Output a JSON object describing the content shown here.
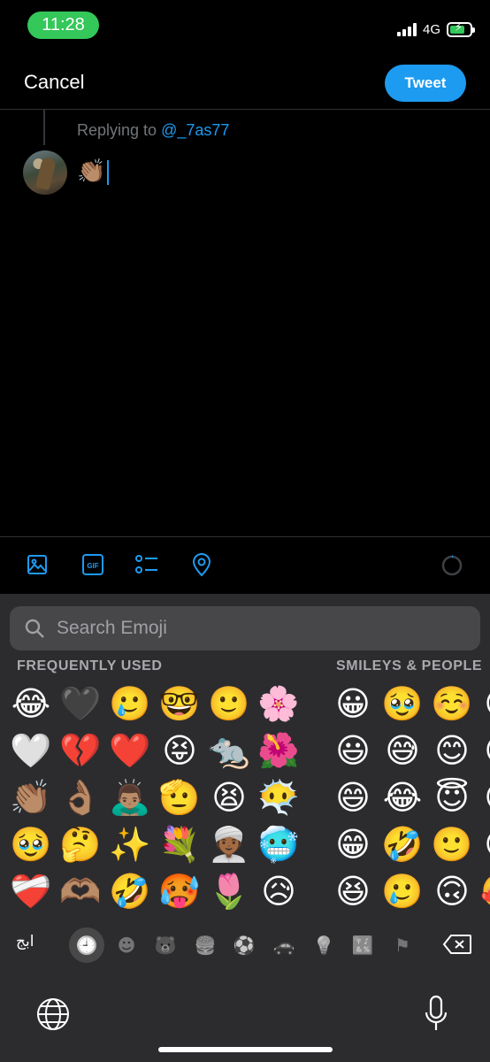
{
  "status_bar": {
    "time": "11:28",
    "network": "4G"
  },
  "header": {
    "cancel_label": "Cancel",
    "tweet_label": "Tweet"
  },
  "reply": {
    "prefix": "Replying to",
    "handle": "@_7as77"
  },
  "draft_text": "👏🏽",
  "keyboard": {
    "search_placeholder": "Search Emoji",
    "sections": {
      "frequent": "FREQUENTLY USED",
      "smileys": "SMILEYS & PEOPLE"
    },
    "frequent_columns": [
      [
        "😂",
        "🤍",
        "👏🏽",
        "🥹",
        "❤️‍🩹"
      ],
      [
        "🖤",
        "💔",
        "👌🏽",
        "🤔",
        "🫶🏽"
      ],
      [
        "🥲",
        "❤️",
        "🙇🏽‍♂️",
        "✨",
        "🤣"
      ],
      [
        "🤓",
        "😝",
        "🫡",
        "💐",
        "🥵"
      ],
      [
        "🙂",
        "🐀",
        "😫",
        "👳🏾‍♀️",
        "🌷"
      ],
      [
        "🌸",
        "🌺",
        "😶‍🌫️",
        "🥶",
        "😥"
      ]
    ],
    "smileys_columns": [
      [
        "😀",
        "😃",
        "😄",
        "😁",
        "😆"
      ],
      [
        "🥹",
        "😅",
        "😂",
        "🤣",
        "🥲"
      ],
      [
        "☺️",
        "😊",
        "😇",
        "🙂",
        "🙃"
      ],
      [
        "🙃",
        "😉",
        "😌",
        "😍",
        "🥰"
      ]
    ],
    "abc_label": "ابج",
    "categories": [
      {
        "icon": "🕘",
        "name": "recent"
      },
      {
        "icon": "☻",
        "name": "smileys"
      },
      {
        "icon": "🐻",
        "name": "animals"
      },
      {
        "icon": "🍔",
        "name": "food"
      },
      {
        "icon": "⚽",
        "name": "activity"
      },
      {
        "icon": "🚗",
        "name": "travel"
      },
      {
        "icon": "💡",
        "name": "objects"
      },
      {
        "icon": "🔣",
        "name": "symbols"
      },
      {
        "icon": "⚑",
        "name": "flags"
      }
    ]
  },
  "colors": {
    "accent": "#1d9bf0",
    "status_green": "#34c759",
    "keyboard_bg": "#2c2c2e"
  }
}
